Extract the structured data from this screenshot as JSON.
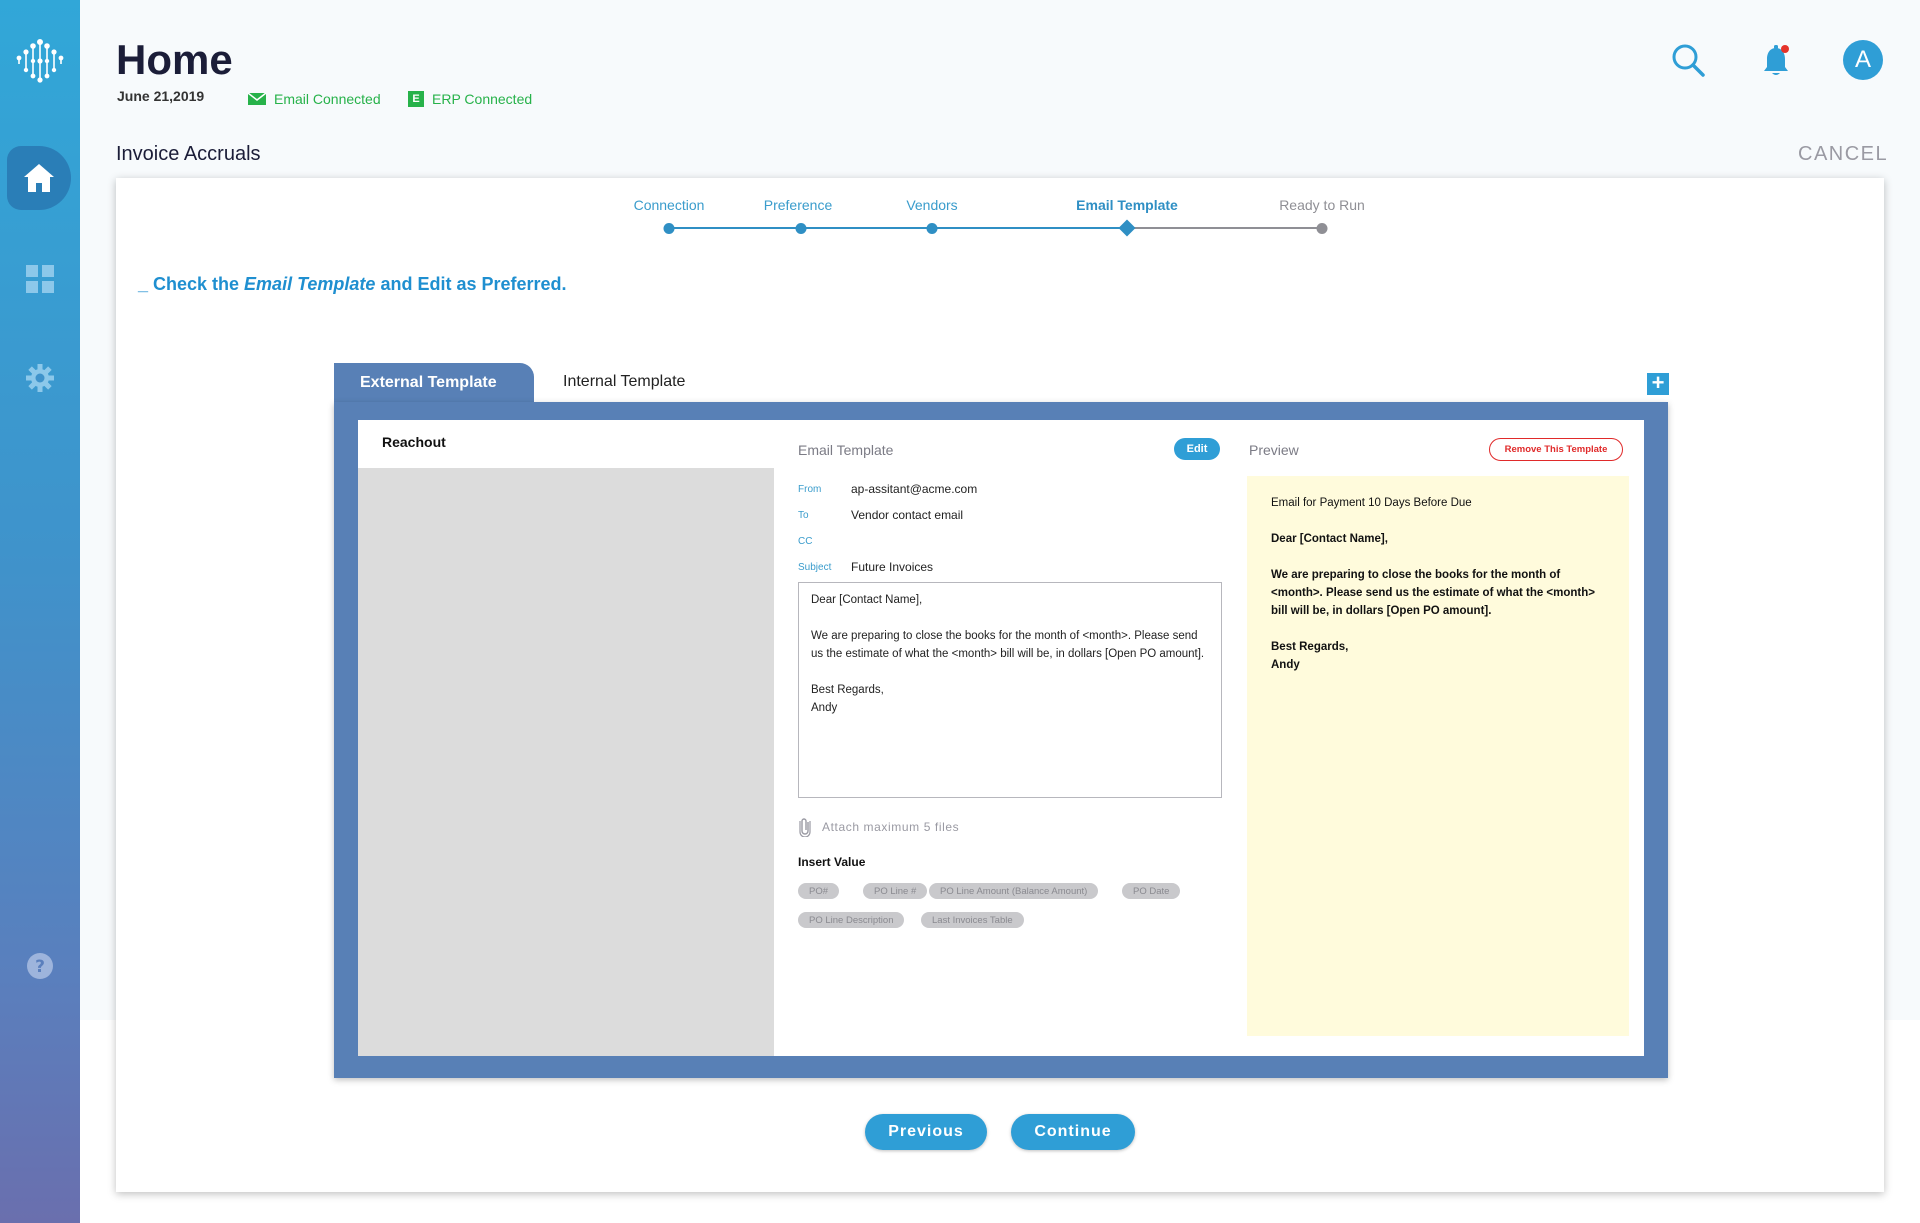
{
  "header": {
    "title": "Home",
    "date": "June 21,2019",
    "email_status": "Email Connected",
    "erp_badge": "E",
    "erp_status": "ERP Connected",
    "avatar_initial": "A"
  },
  "section": {
    "title": "Invoice Accruals",
    "cancel_label": "CANCEL"
  },
  "stepper": {
    "steps": [
      {
        "label": "Connection",
        "state": "done"
      },
      {
        "label": "Preference",
        "state": "done"
      },
      {
        "label": "Vendors",
        "state": "done"
      },
      {
        "label": "Email Template",
        "state": "active"
      },
      {
        "label": "Ready to Run",
        "state": "pending"
      }
    ]
  },
  "instruction": {
    "prefix": "_ Check the ",
    "emphasis": "Email Template",
    "suffix": " and Edit as Preferred."
  },
  "tabs": {
    "external": "External Template",
    "internal": "Internal Template",
    "add_label": "+"
  },
  "reachout": {
    "title": "Reachout"
  },
  "email_template": {
    "heading": "Email Template",
    "edit_label": "Edit",
    "from_label": "From",
    "from_value": "ap-assitant@acme.com",
    "to_label": "To",
    "to_value": "Vendor contact email",
    "cc_label": "CC",
    "cc_value": "",
    "subject_label": "Subject",
    "subject_value": "Future Invoices",
    "body_greeting": "Dear [Contact Name],",
    "body_text": "We are preparing to close the books for the month of <month>. Please send us the estimate of what the <month> bill will be, in dollars [Open PO amount].",
    "body_closing": "Best Regards,",
    "body_signature": "Andy",
    "attach_label": "Attach maximum 5 files",
    "insert_title": "Insert Value",
    "chips": [
      "PO#",
      "PO Line #",
      "PO Line Amount (Balance Amount)",
      "PO Date",
      "PO Line Description",
      "Last Invoices Table"
    ]
  },
  "preview": {
    "heading": "Preview",
    "remove_label": "Remove This Template",
    "subject": "Email for Payment 10 Days Before Due",
    "greeting": "Dear [Contact Name],",
    "text": "We are preparing to close the books for the month of <month>. Please send us the estimate of what the <month> bill will be, in dollars [Open PO amount].",
    "closing": "Best Regards,",
    "signature": "Andy"
  },
  "footer": {
    "previous_label": "Previous",
    "continue_label": "Continue"
  },
  "colors": {
    "accent": "#2f9ed6",
    "connected": "#27b24a",
    "panel": "#5880b6",
    "danger": "#e02a2a",
    "preview_bg": "#fffbdc"
  },
  "icons": {
    "logo": "brand-logo-icon",
    "home": "home-icon",
    "dashboard": "grid-icon",
    "settings": "gear-icon",
    "help": "help-icon",
    "search": "search-icon",
    "notifications": "bell-icon",
    "email": "envelope-icon",
    "attach": "paperclip-icon"
  }
}
